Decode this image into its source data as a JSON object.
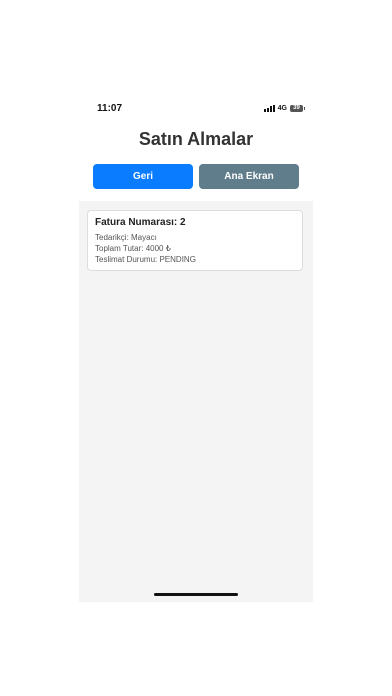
{
  "status_bar": {
    "time": "11:07",
    "network": "4G",
    "battery": "39"
  },
  "header": {
    "title": "Satın Almalar"
  },
  "buttons": {
    "back_label": "Geri",
    "home_label": "Ana Ekran"
  },
  "colors": {
    "back_button": "#0a7cff",
    "home_button": "#607d8b",
    "content_background": "#f4f4f4"
  },
  "invoices": [
    {
      "title": "Fatura Numarası: 2",
      "supplier": "Tedarikçi: Mayacı",
      "total": "Toplam Tutar: 4000 ₺",
      "delivery_status": "Teslimat Durumu: PENDING"
    }
  ]
}
